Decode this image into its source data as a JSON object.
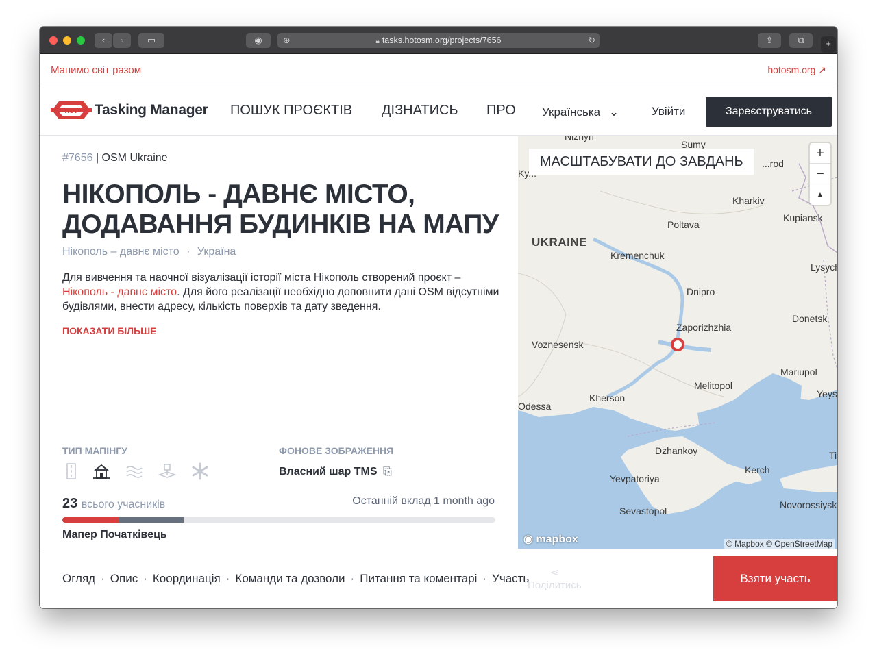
{
  "browser": {
    "url": "tasks.hotosm.org/projects/7656"
  },
  "topbar": {
    "tagline": "Мапимо світ разом",
    "hot_link": "hotosm.org"
  },
  "nav": {
    "logo_badge": "HOT",
    "logo_text": "Tasking Manager",
    "links": [
      "ПОШУК ПРОЄКТІВ",
      "ДІЗНАТИСЬ",
      "ПРО"
    ],
    "language": "Українська",
    "login": "Увійти",
    "signup": "Зареєструватись"
  },
  "project": {
    "id": "#7656",
    "org": "OSM Ukraine",
    "title": "НІКОПОЛЬ - ДАВНЄ МІСТО, ДОДАВАННЯ БУДИНКІВ НА МАПУ",
    "campaign": "Нікополь – давнє місто",
    "country": "Україна",
    "desc_part1": "Для вивчення та наочної візуалізації історії міста Нікополь створений проєкт – ",
    "desc_link": "Нікополь - давнє місто",
    "desc_part2": ". Для його реалізації необхідно доповнити дані OSM відсутніми будівлями, внести адресу, кількість поверхів та дату зведення.",
    "show_more": "ПОКАЗАТИ БІЛЬШЕ",
    "mapping_type_label": "ТИП МАПІНГУ",
    "mapping_icons": [
      "roads-icon",
      "buildings-icon",
      "waterways-icon",
      "landuse-icon",
      "other-icon"
    ],
    "imagery_label": "ФОНОВЕ ЗОБРАЖЕННЯ",
    "imagery_value": "Власний шар TMS",
    "contributors_count": "23",
    "contributors_label": "всього учасників",
    "last_contribution": "Останній вклад 1 month ago",
    "progress": {
      "mapped_pct": 13,
      "validated_pct": 15
    },
    "mapper_level": "Мапер Початківець"
  },
  "map": {
    "zoom_to_tasks": "МАСШТАБУВАТИ ДО ЗАВДАНЬ",
    "zoom_in": "+",
    "zoom_out": "−",
    "compass": "▲",
    "attribution": "© Mapbox © OpenStreetMap",
    "logo": "mapbox",
    "country_label": "UKRAINE",
    "cities": [
      "Nizhyn",
      "Sumy",
      "Ky...",
      "...rod",
      "Kharkiv",
      "Poltava",
      "Kupiansk",
      "Kremenchuk",
      "Lysych...",
      "Dnipro",
      "Zaporizhzhia",
      "Donetsk",
      "Voznesensk",
      "Mariupol",
      "Melitopol",
      "Kherson",
      "Yeys...",
      "Odessa",
      "Dzhankoy",
      "Ti...",
      "Kerch",
      "Yevpatoriya",
      "Sevastopol",
      "Novorossiysk"
    ]
  },
  "bottom": {
    "tabs": [
      "Огляд",
      "Опис",
      "Координація",
      "Команди та дозволи",
      "Питання та коментарі",
      "Участь"
    ],
    "share": "Поділитись",
    "join": "Взяти участь"
  }
}
